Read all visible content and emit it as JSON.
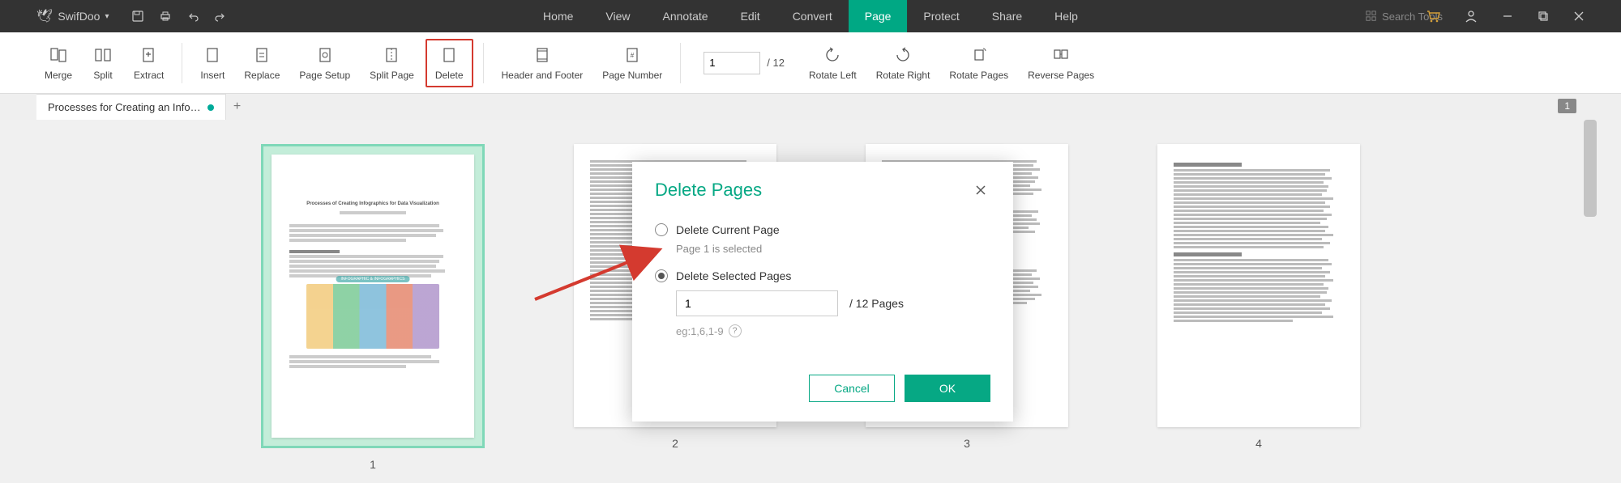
{
  "app": {
    "name": "SwifDoo"
  },
  "menubar": {
    "items": [
      "Home",
      "View",
      "Annotate",
      "Edit",
      "Convert",
      "Page",
      "Protect",
      "Share",
      "Help"
    ],
    "active_index": 5,
    "search_placeholder": "Search Tools"
  },
  "ribbon": {
    "merge": "Merge",
    "split": "Split",
    "extract": "Extract",
    "insert": "Insert",
    "replace": "Replace",
    "page_setup": "Page Setup",
    "split_page": "Split Page",
    "delete": "Delete",
    "header_footer": "Header and Footer",
    "page_number": "Page Number",
    "current_page": "1",
    "total_pages": "/ 12",
    "rotate_left": "Rotate Left",
    "rotate_right": "Rotate Right",
    "rotate_pages": "Rotate Pages",
    "reverse_pages": "Reverse Pages"
  },
  "tab": {
    "title": "Processes for Creating an Info…",
    "page_badge": "1"
  },
  "pages": {
    "count": 4,
    "labels": [
      "1",
      "2",
      "3",
      "4"
    ]
  },
  "dialog": {
    "title": "Delete Pages",
    "opt1": "Delete Current Page",
    "opt1_sub": "Page 1 is selected",
    "opt2": "Delete Selected Pages",
    "input_value": "1",
    "input_suffix": "/ 12 Pages",
    "example": "eg:1,6,1-9",
    "cancel": "Cancel",
    "ok": "OK"
  }
}
